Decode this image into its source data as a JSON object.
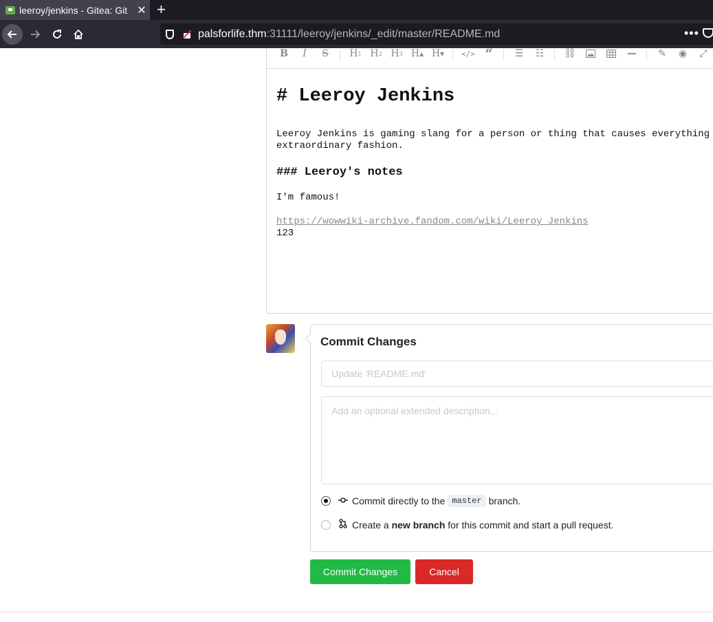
{
  "browser": {
    "tab_title": "leeroy/jenkins - Gitea: Git",
    "tab_close": "✕",
    "new_tab": "+",
    "url_host": "palsforlife.thm",
    "url_rest": ":31111/leeroy/jenkins/_edit/master/README.md",
    "menu": "•••"
  },
  "toolbar": {
    "icons": [
      "bold-icon",
      "italic-icon",
      "strikethrough-icon",
      "heading-1-icon",
      "heading-2-icon",
      "heading-3-icon",
      "heading-bigger-icon",
      "heading-smaller-icon",
      "code-icon",
      "quote-icon",
      "unordered-list-icon",
      "ordered-list-icon",
      "link-icon",
      "image-icon",
      "table-icon",
      "horizontal-rule-icon",
      "eraser-icon",
      "preview-icon",
      "fullscreen-icon"
    ]
  },
  "editor": {
    "h1": "# Leeroy Jenkins",
    "para_line1": "Leeroy Jenkins is gaming slang for a person or thing that causes everything",
    "para_line2": "extraordinary fashion.",
    "h3": "### Leeroy's notes",
    "p2": "I'm famous!",
    "link": "https://wowwiki-archive.fandom.com/wiki/Leeroy_Jenkins",
    "p3": "123"
  },
  "commit": {
    "title": "Commit Changes",
    "summary_placeholder": "Update 'README.md'",
    "description_placeholder": "Add an optional extended description...",
    "option1_prefix": "Commit directly to the",
    "option1_branch": "master",
    "option1_suffix": "branch.",
    "option2_prefix": "Create a",
    "option2_bold": "new branch",
    "option2_suffix": "for this commit and start a pull request.",
    "selected_option": 1,
    "commit_button": "Commit Changes",
    "cancel_button": "Cancel"
  },
  "colors": {
    "commit_button": "#21ba45",
    "cancel_button": "#db2828"
  }
}
